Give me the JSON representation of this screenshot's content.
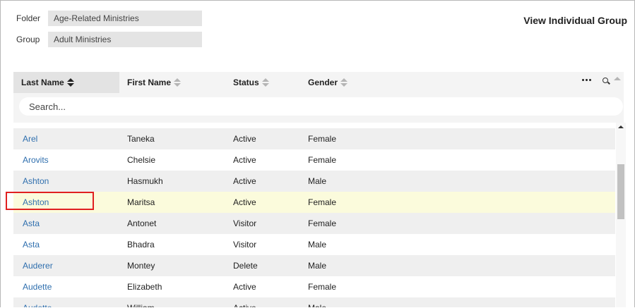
{
  "folder": {
    "label": "Folder",
    "value": "Age-Related Ministries"
  },
  "group": {
    "label": "Group",
    "value": "Adult Ministries"
  },
  "view_title": "View Individual Group",
  "columns": [
    {
      "label": "Last Name",
      "sort": "active"
    },
    {
      "label": "First Name",
      "sort": "none"
    },
    {
      "label": "Status",
      "sort": "none"
    },
    {
      "label": "Gender",
      "sort": "none"
    }
  ],
  "toolbar": {
    "more_icon": "more-horizontal-icon",
    "search_icon": "search-icon",
    "collapse_icon": "chevron-up-icon"
  },
  "search": {
    "placeholder": "Search..."
  },
  "rows": [
    {
      "last": "Arel",
      "first": "Taneka",
      "status": "Active",
      "gender": "Female"
    },
    {
      "last": "Arovits",
      "first": "Chelsie",
      "status": "Active",
      "gender": "Female"
    },
    {
      "last": "Ashton",
      "first": "Hasmukh",
      "status": "Active",
      "gender": "Male"
    },
    {
      "last": "Ashton",
      "first": "Maritsa",
      "status": "Active",
      "gender": "Female"
    },
    {
      "last": "Asta",
      "first": "Antonet",
      "status": "Visitor",
      "gender": "Female"
    },
    {
      "last": "Asta",
      "first": "Bhadra",
      "status": "Visitor",
      "gender": "Male"
    },
    {
      "last": "Auderer",
      "first": "Montey",
      "status": "Delete",
      "gender": "Male"
    },
    {
      "last": "Audette",
      "first": "Elizabeth",
      "status": "Active",
      "gender": "Female"
    },
    {
      "last": "Audette",
      "first": "William",
      "status": "Active",
      "gender": "Male"
    }
  ],
  "colors": {
    "link": "#2f6fae",
    "highlight_row": "#fbfbdc",
    "selection_border": "#e02020"
  }
}
